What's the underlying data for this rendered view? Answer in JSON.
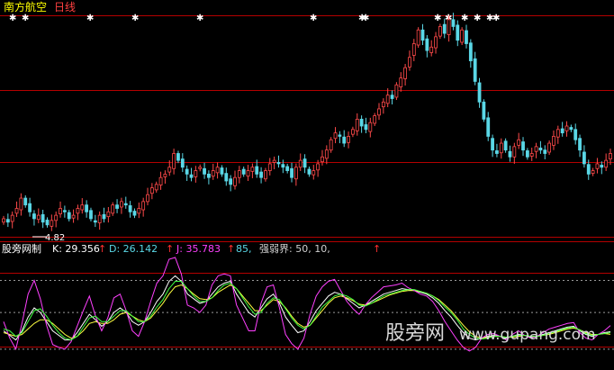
{
  "chart_title": {
    "stock": "南方航空",
    "period": "日线"
  },
  "low_label": "4.82",
  "indicator": {
    "name": "股旁网制",
    "k": "K: 29.356",
    "d": "D: 26.142",
    "j": "J: 35.783",
    "level_85": "85,",
    "threshold": "强弱界: 50, 10,",
    "arrow": "↑"
  },
  "watermark": {
    "cn": "股旁网",
    "url": "www.gupang.com"
  },
  "colors": {
    "up_candle": "#ff4a4a",
    "down_candle": "#5ad7e6",
    "price_grid": "#b40000",
    "k_line": "#ffffff",
    "d_line": "#ffff40",
    "j_line": "#ff40ff",
    "extra_line": "#40ff40",
    "title_text": "#ffff00"
  },
  "chart_data": [
    {
      "type": "candlestick",
      "title": "南方航空 日线",
      "series": [
        {
          "name": "price",
          "close": [
            5.0,
            4.9,
            5.1,
            5.3,
            5.6,
            5.4,
            5.2,
            5.0,
            5.1,
            4.9,
            4.82,
            4.95,
            5.1,
            5.3,
            5.2,
            5.0,
            5.1,
            5.3,
            5.4,
            5.2,
            5.0,
            4.9,
            5.1,
            5.0,
            5.2,
            5.4,
            5.3,
            5.5,
            5.4,
            5.2,
            5.1,
            5.3,
            5.5,
            5.7,
            5.9,
            6.0,
            6.2,
            6.3,
            6.5,
            6.9,
            6.7,
            6.5,
            6.3,
            6.2,
            6.4,
            6.5,
            6.3,
            6.2,
            6.4,
            6.5,
            6.3,
            6.1,
            6.0,
            6.2,
            6.4,
            6.3,
            6.4,
            6.5,
            6.3,
            6.2,
            6.4,
            6.6,
            6.7,
            6.6,
            6.5,
            6.4,
            6.2,
            6.5,
            6.7,
            6.5,
            6.3,
            6.4,
            6.6,
            6.8,
            7.0,
            7.3,
            7.5,
            7.4,
            7.2,
            7.4,
            7.6,
            7.9,
            7.7,
            7.6,
            7.8,
            8.0,
            8.2,
            8.4,
            8.6,
            8.5,
            8.9,
            9.1,
            9.4,
            9.7,
            10.1,
            10.5,
            10.2,
            9.9,
            10.0,
            10.3,
            10.6,
            10.4,
            10.8,
            10.6,
            10.2,
            10.5,
            10.1,
            9.6,
            9.0,
            8.4,
            7.9,
            7.4,
            7.0,
            6.9,
            7.2,
            7.0,
            6.8,
            7.1,
            7.3,
            7.0,
            6.8,
            6.9,
            7.1,
            7.0,
            6.9,
            7.2,
            7.4,
            7.6,
            7.5,
            7.7,
            7.6,
            7.3,
            7.0,
            6.6,
            6.3,
            6.4,
            6.6,
            6.5,
            6.7,
            6.9
          ],
          "low_marker": 4.82
        }
      ],
      "markers": "star row above the candles"
    },
    {
      "type": "line",
      "series": [
        {
          "name": "K",
          "values": [
            30,
            25,
            20,
            30,
            45,
            55,
            50,
            40,
            30,
            25,
            20,
            20,
            28,
            38,
            48,
            42,
            35,
            40,
            50,
            55,
            50,
            40,
            36,
            40,
            50,
            62,
            70,
            84,
            90,
            84,
            70,
            65,
            60,
            62,
            70,
            78,
            82,
            84,
            70,
            60,
            50,
            45,
            55,
            65,
            70,
            60,
            45,
            36,
            28,
            30,
            40,
            52,
            60,
            68,
            72,
            70,
            65,
            60,
            55,
            58,
            62,
            66,
            70,
            72,
            74,
            76,
            75,
            74,
            72,
            70,
            66,
            60,
            52,
            45,
            36,
            28,
            22,
            20,
            22,
            24,
            25,
            24,
            22,
            24,
            26,
            25,
            23,
            24,
            26,
            28,
            30,
            32,
            34,
            35,
            30,
            26,
            24,
            26,
            28,
            29
          ]
        },
        {
          "name": "D",
          "values": [
            28,
            26,
            24,
            26,
            32,
            38,
            42,
            42,
            38,
            32,
            26,
            22,
            24,
            30,
            38,
            40,
            38,
            38,
            42,
            48,
            50,
            46,
            42,
            40,
            44,
            52,
            60,
            70,
            78,
            80,
            76,
            70,
            65,
            64,
            66,
            72,
            76,
            80,
            76,
            68,
            60,
            52,
            52,
            58,
            64,
            62,
            55,
            46,
            38,
            34,
            36,
            44,
            52,
            60,
            66,
            68,
            66,
            63,
            59,
            58,
            60,
            63,
            66,
            69,
            71,
            73,
            74,
            74,
            73,
            71,
            68,
            64,
            58,
            52,
            44,
            36,
            29,
            24,
            22,
            23,
            24,
            24,
            23,
            23,
            24,
            25,
            24,
            24,
            25,
            26,
            28,
            30,
            32,
            33,
            31,
            28,
            26,
            26,
            27,
            26.142
          ]
        },
        {
          "name": "J",
          "values": [
            40,
            22,
            10,
            38,
            70,
            85,
            65,
            36,
            15,
            12,
            10,
            18,
            35,
            52,
            68,
            46,
            30,
            44,
            66,
            70,
            52,
            30,
            24,
            40,
            62,
            82,
            90,
            108,
            112,
            92,
            58,
            55,
            50,
            58,
            80,
            90,
            92,
            90,
            58,
            44,
            30,
            30,
            60,
            78,
            80,
            55,
            26,
            16,
            10,
            22,
            48,
            68,
            78,
            84,
            86,
            74,
            62,
            54,
            48,
            58,
            66,
            72,
            78,
            79,
            80,
            82,
            77,
            74,
            70,
            68,
            62,
            52,
            40,
            30,
            20,
            12,
            8,
            12,
            22,
            26,
            27,
            24,
            20,
            26,
            30,
            25,
            22,
            24,
            28,
            32,
            34,
            36,
            38,
            39,
            28,
            22,
            20,
            26,
            30,
            35.783
          ]
        },
        {
          "name": "85",
          "values": [
            32,
            30,
            24,
            28,
            40,
            52,
            54,
            46,
            36,
            28,
            22,
            20,
            24,
            34,
            44,
            46,
            40,
            40,
            46,
            52,
            52,
            46,
            40,
            40,
            46,
            56,
            64,
            76,
            84,
            84,
            76,
            68,
            62,
            62,
            66,
            74,
            80,
            82,
            76,
            66,
            56,
            48,
            50,
            60,
            66,
            64,
            54,
            44,
            36,
            32,
            36,
            46,
            56,
            62,
            68,
            70,
            68,
            64,
            58,
            57,
            60,
            64,
            68,
            70,
            72,
            74,
            75,
            75,
            73,
            71,
            68,
            63,
            56,
            50,
            42,
            32,
            26,
            22,
            21,
            22,
            24,
            24,
            23,
            24,
            25,
            25,
            24,
            24,
            25,
            27,
            29,
            31,
            33,
            34,
            31,
            27,
            25,
            26,
            27,
            28
          ]
        }
      ],
      "ylim": [
        0,
        110
      ],
      "reference_levels": [
        85,
        50,
        10
      ]
    }
  ]
}
